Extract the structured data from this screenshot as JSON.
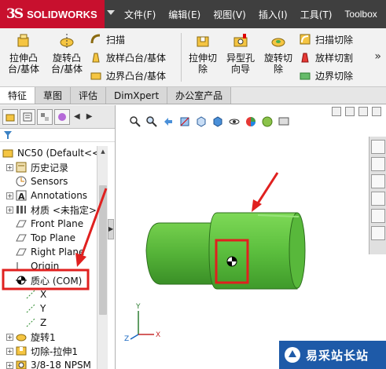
{
  "app": {
    "logo_text": "SOLIDWORKS",
    "brand_color": "#c8102e"
  },
  "menubar": {
    "items": [
      "文件(F)",
      "编辑(E)",
      "视图(V)",
      "插入(I)",
      "工具(T)",
      "Toolbox"
    ]
  },
  "ribbon": {
    "boss_extrude": "拉伸凸\n台/基体",
    "boss_revolve": "旋转凸\n台/基体",
    "sweep": "扫描",
    "loft": "放样凸台/基体",
    "boundary": "边界凸台/基体",
    "cut_extrude": "拉伸切\n除",
    "hole_wizard": "异型孔\n向导",
    "cut_revolve": "旋转切\n除",
    "swept_cut": "扫描切除",
    "lofted_cut": "放样切割",
    "boundary_cut": "边界切除",
    "more": "»"
  },
  "tabs": [
    {
      "label": "特征",
      "active": true
    },
    {
      "label": "草图",
      "active": false
    },
    {
      "label": "评估",
      "active": false
    },
    {
      "label": "DimXpert",
      "active": false
    },
    {
      "label": "办公室产品",
      "active": false
    }
  ],
  "feature_tree": {
    "items": [
      {
        "label": "NC50  (Default<<",
        "icon": "part-icon"
      },
      {
        "label": "历史记录",
        "icon": "history-icon"
      },
      {
        "label": "Sensors",
        "icon": "sensor-icon"
      },
      {
        "label": "Annotations",
        "icon": "annotation-icon"
      },
      {
        "label": "材质 <未指定>",
        "icon": "material-icon"
      },
      {
        "label": "Front Plane",
        "icon": "plane-icon"
      },
      {
        "label": "Top Plane",
        "icon": "plane-icon"
      },
      {
        "label": "Right Plane",
        "icon": "plane-icon"
      },
      {
        "label": "Origin",
        "icon": "origin-icon"
      },
      {
        "label": "质心 (COM)",
        "icon": "center-of-mass-icon"
      },
      {
        "label": "X",
        "icon": "axis-icon"
      },
      {
        "label": "Y",
        "icon": "axis-icon"
      },
      {
        "label": "Z",
        "icon": "axis-icon"
      },
      {
        "label": "旋转1",
        "icon": "revolve-icon"
      },
      {
        "label": "切除-拉伸1",
        "icon": "cut-extrude-icon"
      },
      {
        "label": "3/8-18 NPSM",
        "icon": "hole-icon"
      }
    ]
  },
  "triad": {
    "x": "X",
    "y": "Y",
    "z": "Z"
  },
  "watermark": {
    "text": "易采站长站"
  },
  "colors": {
    "part_green": "#5cbf3e",
    "annotation_red": "#e0201f"
  }
}
